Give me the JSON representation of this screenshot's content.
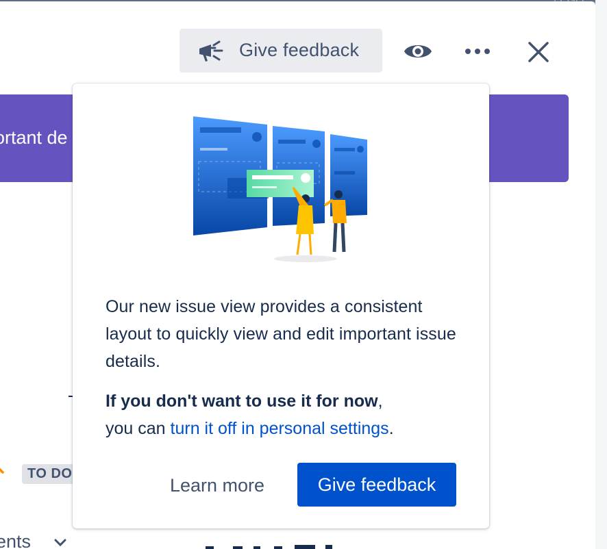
{
  "header": {
    "feedback_label": "Give feedback",
    "icons": [
      "megaphone-icon",
      "eye-icon",
      "more-icon",
      "close-icon"
    ]
  },
  "background": {
    "banner_text": "ortant de",
    "status_label": "TO DO",
    "bottom_label": "ents",
    "side_text": "LEGO"
  },
  "popover": {
    "body_text": "Our new issue view provides a consistent layout to quickly view and edit important issue details.",
    "opt_out_bold": "If you don't want to use it for now",
    "opt_out_comma": ",",
    "opt_out_prefix": "you can",
    "opt_out_link": "turn it off in personal settings",
    "opt_out_suffix": ".",
    "learn_more_label": "Learn more",
    "feedback_button_label": "Give feedback"
  },
  "colors": {
    "primary": "#0052cc",
    "banner": "#6554c0",
    "text": "#172b4d",
    "subtle_text": "#42526e",
    "button_neutral": "#ebecf0"
  }
}
